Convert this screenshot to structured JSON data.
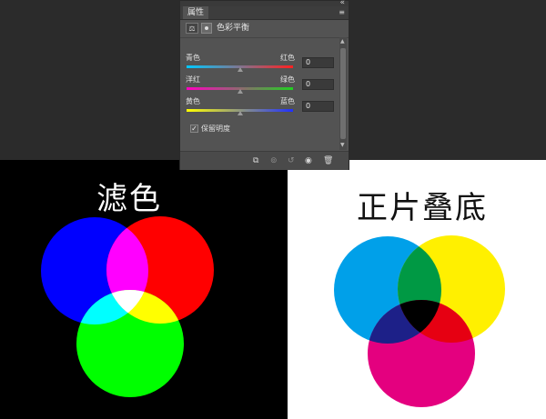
{
  "properties_panel": {
    "tab_label": "属性",
    "menu_icon": "≡",
    "collapse_icon": "«",
    "adjustment_title": "色彩平衡",
    "sliders": [
      {
        "left_label": "青色",
        "right_label": "红色",
        "value": "0",
        "left_color": "#00c8ff",
        "right_color": "#ff2020"
      },
      {
        "left_label": "洋红",
        "right_label": "绿色",
        "value": "0",
        "left_color": "#ff00c0",
        "right_color": "#20d020"
      },
      {
        "left_label": "黄色",
        "right_label": "蓝色",
        "value": "0",
        "left_color": "#ffff00",
        "right_color": "#2030ff"
      }
    ],
    "preserve_luminosity_label": "保留明度",
    "preserve_luminosity_checked": true,
    "check_mark": "✓",
    "footer_icons": [
      "clip-to-layer-icon",
      "view-previous-icon",
      "reset-icon",
      "visibility-eye-icon",
      "delete-icon"
    ]
  },
  "left_panel": {
    "title": "滤色",
    "background": "#000000",
    "circles": {
      "blue": "#0000ff",
      "red": "#ff0000",
      "green": "#00ff00"
    },
    "overlaps": {
      "blue_red": "#ff00ff",
      "blue_green": "#00ffff",
      "red_green": "#ffff00",
      "all": "#ffffff"
    }
  },
  "right_panel": {
    "title": "正片叠底",
    "background": "#ffffff",
    "circles": {
      "cyan": "#00a0e9",
      "yellow": "#fff000",
      "magenta": "#e4007f"
    },
    "overlaps": {
      "cyan_yellow": "#009944",
      "cyan_magenta": "#1d2088",
      "yellow_magenta": "#e60012",
      "all": "#000000"
    }
  }
}
